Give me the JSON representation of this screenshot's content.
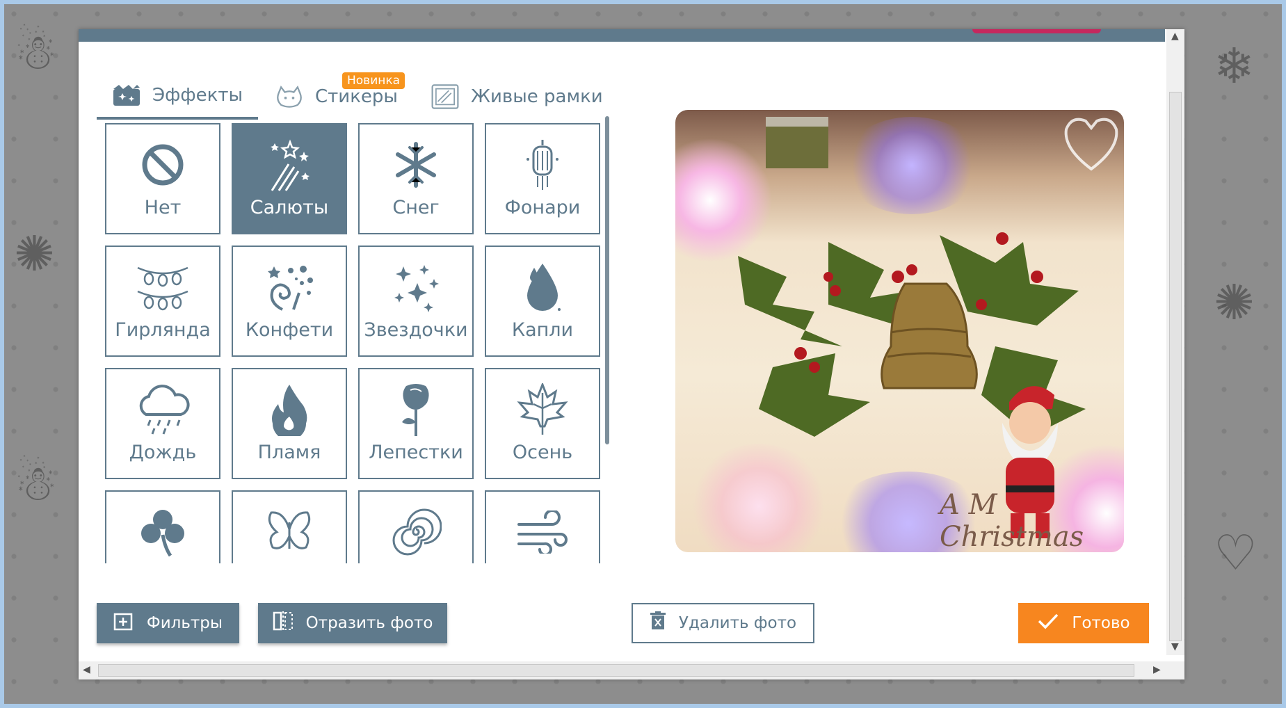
{
  "tabs": [
    {
      "label": "Эффекты",
      "icon": "clapperboard-sparkle-icon"
    },
    {
      "label": "Стикеры",
      "icon": "cat-sticker-icon",
      "badge": "Новинка"
    },
    {
      "label": "Живые рамки",
      "icon": "frame-icon"
    }
  ],
  "effects": [
    {
      "label": "Нет",
      "icon": "none-icon"
    },
    {
      "label": "Салюты",
      "icon": "fireworks-icon",
      "selected": true
    },
    {
      "label": "Снег",
      "icon": "snowflake-icon"
    },
    {
      "label": "Фонари",
      "icon": "lantern-icon"
    },
    {
      "label": "Гирлянда",
      "icon": "garland-icon"
    },
    {
      "label": "Конфети",
      "icon": "confetti-icon"
    },
    {
      "label": "Звездочки",
      "icon": "stars-icon"
    },
    {
      "label": "Капли",
      "icon": "drop-icon"
    },
    {
      "label": "Дождь",
      "icon": "rain-cloud-icon"
    },
    {
      "label": "Пламя",
      "icon": "flame-icon"
    },
    {
      "label": "Лепестки",
      "icon": "rose-icon"
    },
    {
      "label": "Осень",
      "icon": "maple-leaf-icon"
    },
    {
      "label": "",
      "icon": "clover-icon"
    },
    {
      "label": "",
      "icon": "butterfly-icon"
    },
    {
      "label": "",
      "icon": "spiral-icon"
    },
    {
      "label": "",
      "icon": "wind-icon"
    }
  ],
  "preview": {
    "text": "A M Christmas"
  },
  "buttons": {
    "filters": "Фильтры",
    "mirror": "Отразить фото",
    "delete": "Удалить фото",
    "done": "Готово"
  },
  "colors": {
    "primary": "#5f7a8c",
    "accent": "#f7861f",
    "badge": "#f7941d"
  }
}
